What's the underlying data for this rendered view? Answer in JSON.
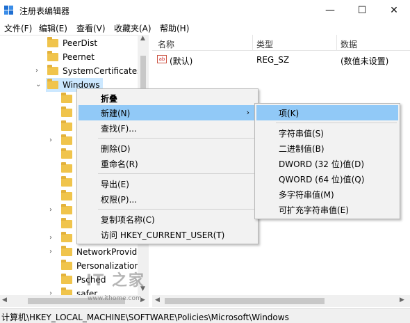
{
  "window": {
    "title": "注册表编辑器",
    "minimize": "—",
    "maximize": "☐",
    "close": "✕"
  },
  "menubar": [
    "文件(F)",
    "编辑(E)",
    "查看(V)",
    "收藏夹(A)",
    "帮助(H)"
  ],
  "tree": {
    "items": [
      {
        "label": "PeerDist"
      },
      {
        "label": "Peernet"
      },
      {
        "label": "SystemCertificates"
      },
      {
        "label": "Windows"
      },
      {
        "label": "NetworkProvide"
      },
      {
        "label": "Personalization"
      },
      {
        "label": "Psched"
      },
      {
        "label": "safer"
      }
    ]
  },
  "list": {
    "headers": {
      "name": "名称",
      "type": "类型",
      "data": "数据"
    },
    "rows": [
      {
        "name": "(默认)",
        "type": "REG_SZ",
        "data": "(数值未设置)",
        "icon_text": "ab"
      }
    ]
  },
  "context_menu": {
    "items": [
      "折叠",
      "新建(N)",
      "查找(F)...",
      "删除(D)",
      "重命名(R)",
      "导出(E)",
      "权限(P)...",
      "复制项名称(C)",
      "访问 HKEY_CURRENT_USER(T)"
    ]
  },
  "submenu": {
    "items": [
      "项(K)",
      "字符串值(S)",
      "二进制值(B)",
      "DWORD (32 位)值(D)",
      "QWORD (64 位)值(Q)",
      "多字符串值(M)",
      "可扩充字符串值(E)"
    ]
  },
  "statusbar": {
    "path": "计算机\\HKEY_LOCAL_MACHINE\\SOFTWARE\\Policies\\Microsoft\\Windows"
  },
  "watermark": {
    "logo": "IT 之家",
    "url": "www.ithome.com"
  }
}
